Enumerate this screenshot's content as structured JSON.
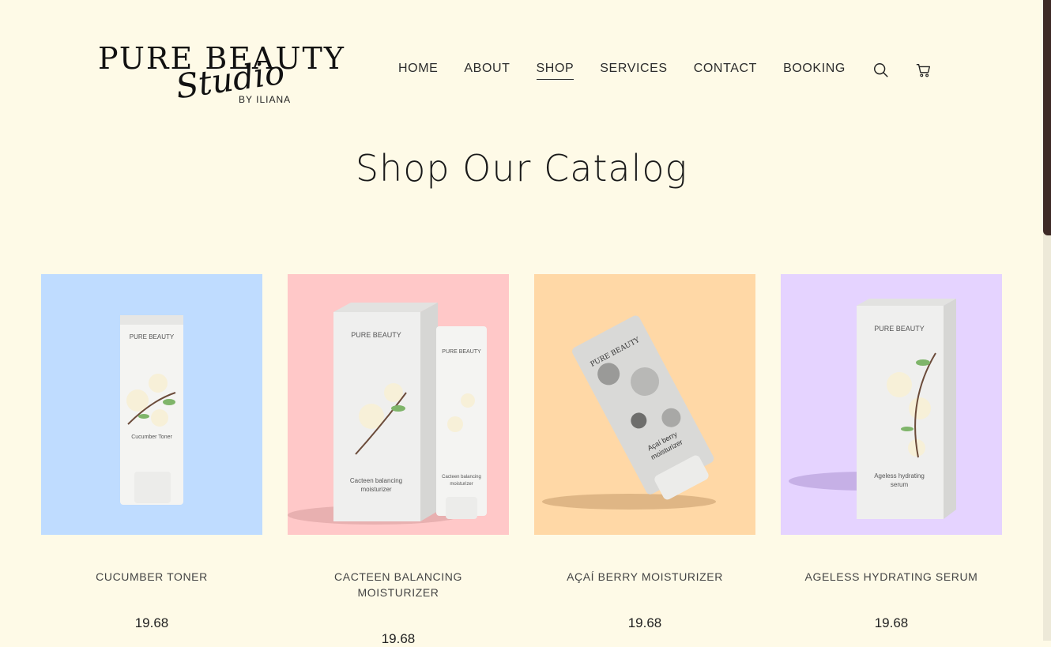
{
  "brand": {
    "line1": "PURE BEAUTY",
    "script": "Studio",
    "byline": "BY ILIANA"
  },
  "nav": {
    "items": [
      {
        "label": "HOME",
        "active": false
      },
      {
        "label": "ABOUT",
        "active": false
      },
      {
        "label": "SHOP",
        "active": true
      },
      {
        "label": "SERVICES",
        "active": false
      },
      {
        "label": "CONTACT",
        "active": false
      },
      {
        "label": "BOOKING",
        "active": false
      }
    ],
    "icons": [
      "search-icon",
      "cart-icon"
    ]
  },
  "page": {
    "title": "Shop Our Catalog"
  },
  "products": [
    {
      "name": "CUCUMBER TONER",
      "price": "19.68",
      "bg": "#bfdcff",
      "pkg_label": "Cucumber Toner"
    },
    {
      "name": "CACTEEN BALANCING MOISTURIZER",
      "price": "19.68",
      "bg": "#ffc8c8",
      "pkg_label": "Cacteen balancing moisturizer"
    },
    {
      "name": "AÇAÍ BERRY MOISTURIZER",
      "price": "19.68",
      "bg": "#ffd8a6",
      "pkg_label": "Açaí berry moisturizer"
    },
    {
      "name": "AGELESS HYDRATING SERUM",
      "price": "19.68",
      "bg": "#e5d3ff",
      "pkg_label": "Ageless hydrating serum"
    }
  ],
  "colors": {
    "page_bg": "#fefae7",
    "scroll_thumb": "#3e2a26"
  }
}
